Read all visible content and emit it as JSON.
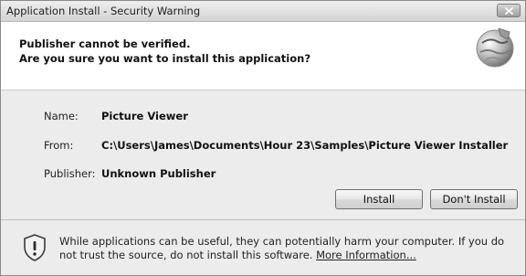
{
  "window": {
    "title": "Application Install - Security Warning"
  },
  "header": {
    "line1": "Publisher cannot be verified.",
    "line2": "Are you sure you want to install this application?"
  },
  "details": {
    "name_label": "Name:",
    "name_value": "Picture Viewer",
    "from_label": "From:",
    "from_value": "C:\\Users\\James\\Documents\\Hour 23\\Samples\\Picture Viewer Installer",
    "publisher_label": "Publisher:",
    "publisher_value": "Unknown Publisher"
  },
  "buttons": {
    "install": "Install",
    "dont_install": "Don't Install"
  },
  "footer": {
    "warning_text": "While applications can be useful, they can potentially harm your computer. If you do not trust the source, do not install this software.",
    "more_info_link": "More Information..."
  },
  "icons": {
    "close": "close-icon",
    "header": "globe-icon",
    "warning": "shield-warning-icon"
  }
}
